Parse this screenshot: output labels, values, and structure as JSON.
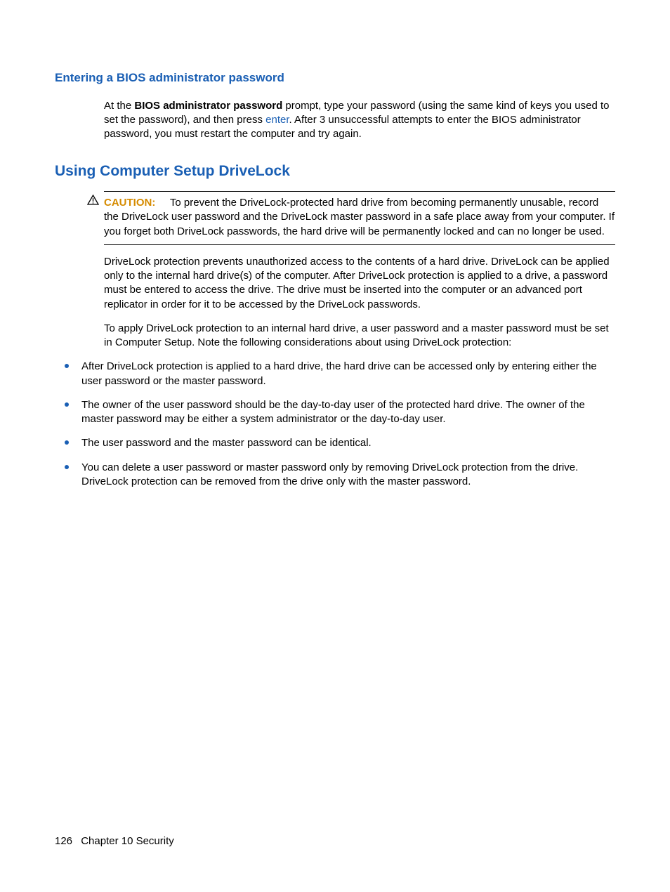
{
  "section1": {
    "heading": "Entering a BIOS administrator password",
    "para_pre": "At the ",
    "para_bold": "BIOS administrator password",
    "para_mid": " prompt, type your password (using the same kind of keys you used to set the password), and then press ",
    "para_key": "enter",
    "para_post": ". After 3 unsuccessful attempts to enter the BIOS administrator password, you must restart the computer and try again."
  },
  "section2": {
    "heading": "Using Computer Setup DriveLock",
    "caution_label": "CAUTION:",
    "caution_text": "To prevent the DriveLock-protected hard drive from becoming permanently unusable, record the DriveLock user password and the DriveLock master password in a safe place away from your computer. If you forget both DriveLock passwords, the hard drive will be permanently locked and can no longer be used.",
    "para1": "DriveLock protection prevents unauthorized access to the contents of a hard drive. DriveLock can be applied only to the internal hard drive(s) of the computer. After DriveLock protection is applied to a drive, a password must be entered to access the drive. The drive must be inserted into the computer or an advanced port replicator in order for it to be accessed by the DriveLock passwords.",
    "para2": "To apply DriveLock protection to an internal hard drive, a user password and a master password must be set in Computer Setup. Note the following considerations about using DriveLock protection:",
    "bullets": [
      "After DriveLock protection is applied to a hard drive, the hard drive can be accessed only by entering either the user password or the master password.",
      "The owner of the user password should be the day-to-day user of the protected hard drive. The owner of the master password may be either a system administrator or the day-to-day user.",
      "The user password and the master password can be identical.",
      "You can delete a user password or master password only by removing DriveLock protection from the drive. DriveLock protection can be removed from the drive only with the master password."
    ]
  },
  "footer": {
    "page": "126",
    "chapter": "Chapter 10   Security"
  }
}
